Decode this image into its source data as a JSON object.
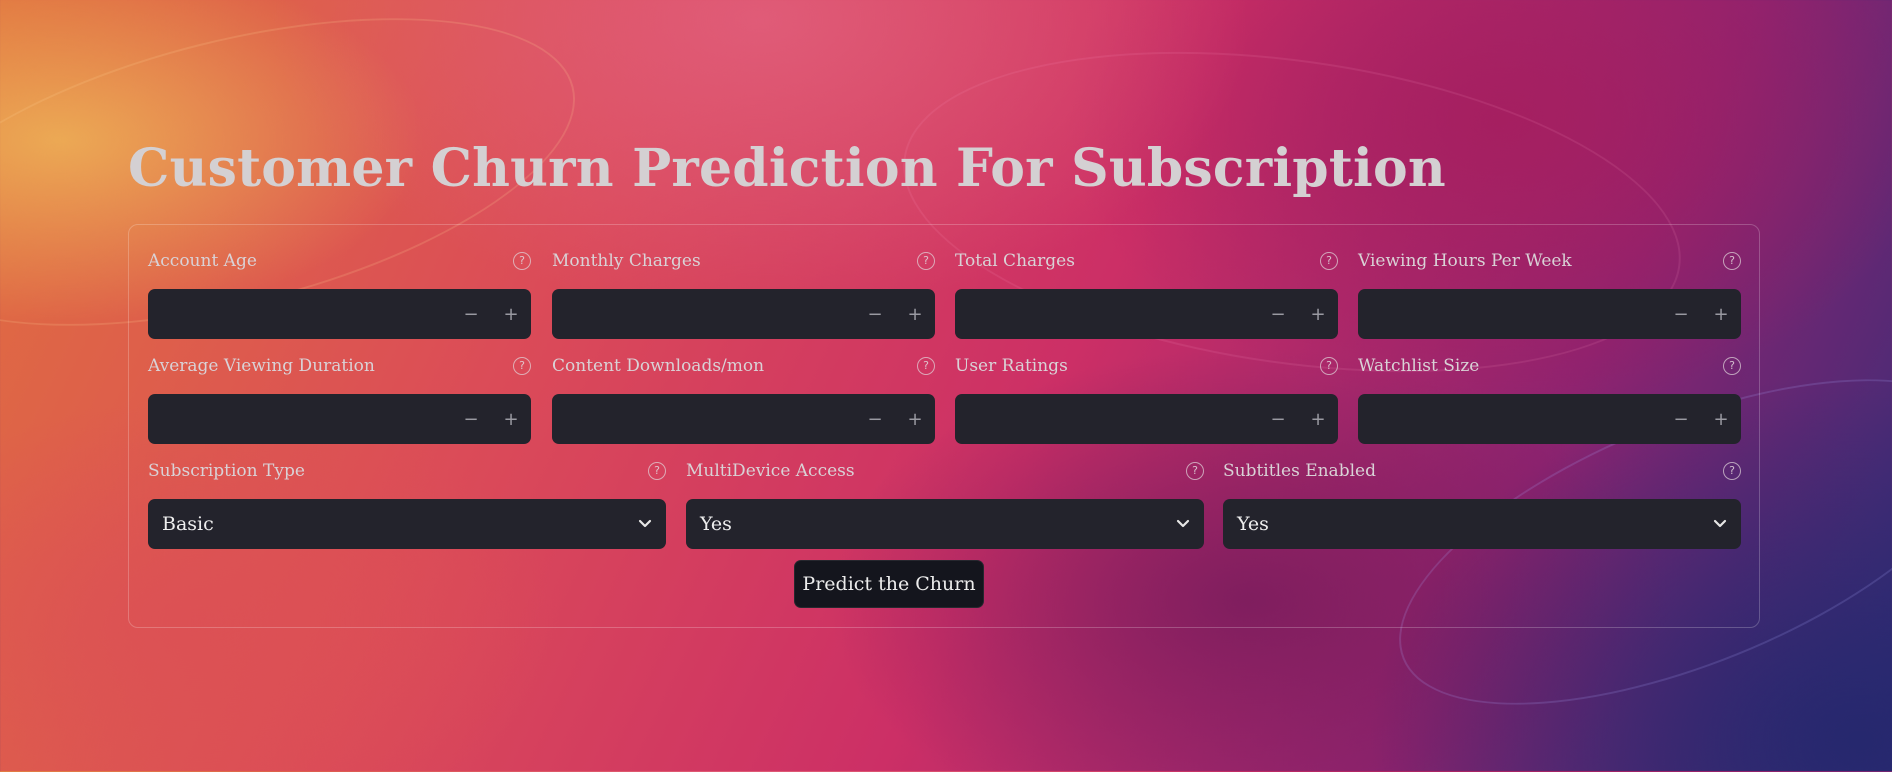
{
  "title": "Customer Churn Prediction For Subscription",
  "numeric_fields": [
    {
      "label": "Account Age"
    },
    {
      "label": "Monthly Charges"
    },
    {
      "label": "Total Charges"
    },
    {
      "label": "Viewing Hours Per Week"
    },
    {
      "label": "Average Viewing Duration"
    },
    {
      "label": "Content Downloads/mon"
    },
    {
      "label": "User Ratings"
    },
    {
      "label": "Watchlist Size"
    }
  ],
  "select_fields": [
    {
      "label": "Subscription Type",
      "value": "Basic"
    },
    {
      "label": "MultiDevice Access",
      "value": "Yes"
    },
    {
      "label": "Subtitles Enabled",
      "value": "Yes"
    }
  ],
  "help_glyph": "?",
  "stepper": {
    "minus": "−",
    "plus": "+"
  },
  "button": {
    "label": "Predict the Churn"
  },
  "colors": {
    "input_bg": "#23232c",
    "button_bg": "#14151d",
    "title": "#d4d0d2"
  }
}
